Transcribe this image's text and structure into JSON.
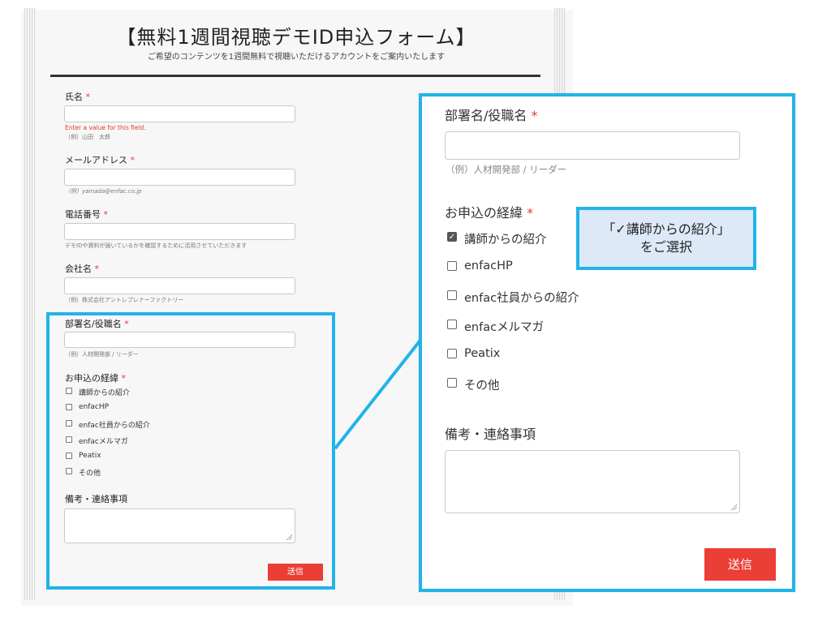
{
  "form": {
    "title": "【無料1週間視聴デモID申込フォーム】",
    "subtitle": "ご希望のコンテンツを1週間無料で視聴いただけるアカウントをご案内いたします",
    "required_mark": "*",
    "fields": {
      "name": {
        "label": "氏名",
        "error": "Enter a value for this field.",
        "hint": "（例）山田　太郎"
      },
      "email": {
        "label": "メールアドレス",
        "hint": "（例）yamada@enfac.co.jp"
      },
      "phone": {
        "label": "電話番号",
        "hint": "デモIDや資料が届いているかを確認するために活用させていただきます"
      },
      "company": {
        "label": "会社名",
        "hint": "（例）株式会社アントレプレナーファクトリー"
      },
      "department": {
        "label": "部署名/役職名",
        "hint": "（例）人材開発部 / リーダー"
      },
      "reason": {
        "label": "お申込の経緯",
        "options": [
          {
            "label": "講師からの紹介",
            "checked": false
          },
          {
            "label": "enfacHP",
            "checked": false
          },
          {
            "label": "enfac社員からの紹介",
            "checked": false
          },
          {
            "label": "enfacメルマガ",
            "checked": false
          },
          {
            "label": "Peatix",
            "checked": false
          },
          {
            "label": "その他",
            "checked": false
          }
        ]
      },
      "notes": {
        "label": "備考・連絡事項"
      }
    },
    "submit_label": "送信"
  },
  "zoom": {
    "department": {
      "label": "部署名/役職名",
      "hint": "（例）人材開発部 / リーダー"
    },
    "reason": {
      "label": "お申込の経緯",
      "options": [
        {
          "label": "講師からの紹介",
          "checked": true
        },
        {
          "label": "enfacHP",
          "checked": false
        },
        {
          "label": "enfac社員からの紹介",
          "checked": false
        },
        {
          "label": "enfacメルマガ",
          "checked": false
        },
        {
          "label": "Peatix",
          "checked": false
        },
        {
          "label": "その他",
          "checked": false
        }
      ]
    },
    "notes": {
      "label": "備考・連絡事項"
    },
    "submit_label": "送信"
  },
  "callout": {
    "line1": "「✓講師からの紹介」",
    "line2": "をご選択"
  },
  "colors": {
    "highlight": "#21b4e8",
    "submit": "#ea3e37",
    "required": "#e53935",
    "callout_bg": "#dde9f7"
  }
}
